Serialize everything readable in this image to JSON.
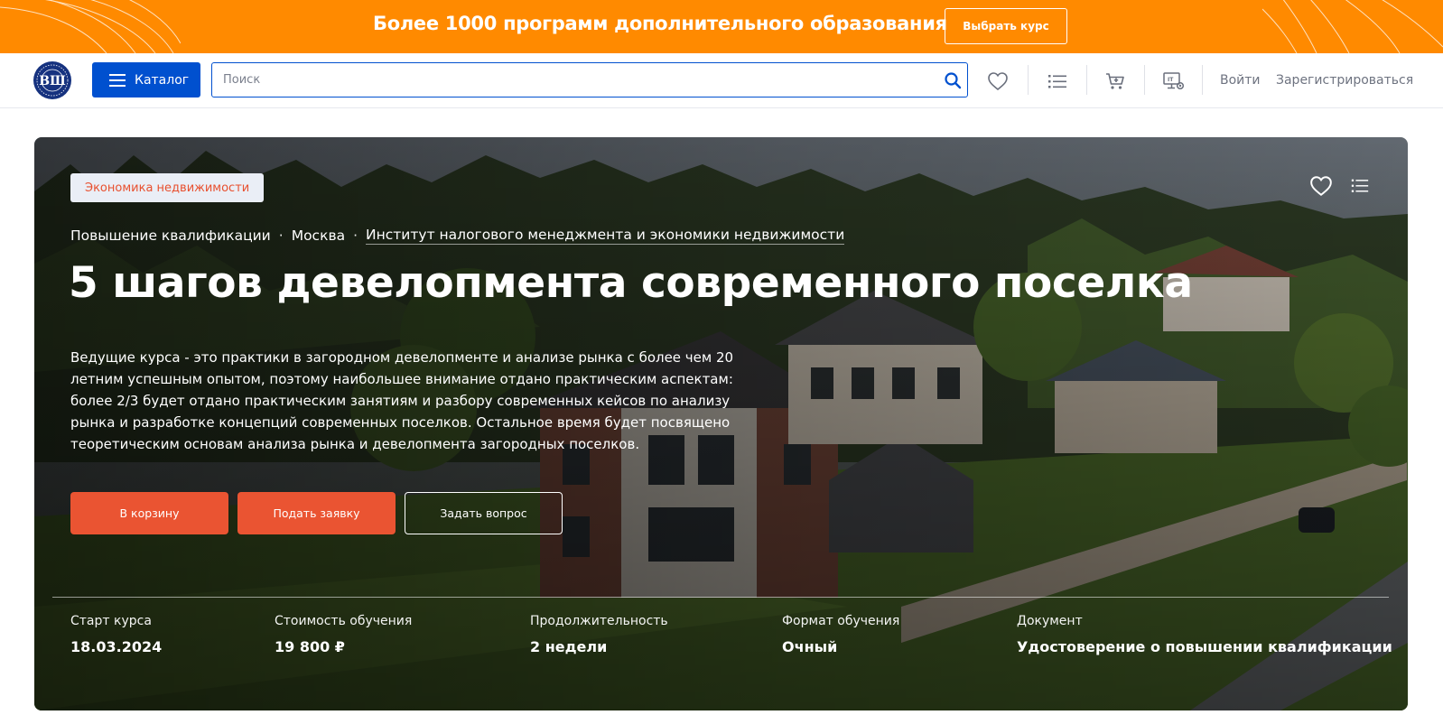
{
  "promo": {
    "text": "Более 1000 программ дополнительного образования",
    "button": "Выбрать курс"
  },
  "header": {
    "logo_icon": "hse-logo-icon",
    "catalog_label": "Каталог",
    "search_placeholder": "Поиск",
    "search_value": "",
    "icons": [
      "heart-icon",
      "list-icon",
      "cart-icon",
      "it-computer-icon"
    ],
    "login": "Войти",
    "register": "Зарегистрироваться"
  },
  "hero": {
    "tag": "Экономика недвижимости",
    "breadcrumbs": [
      "Повышение квалификации",
      "Москва",
      "Институт налогового менеджмента и экономики недвижимости"
    ],
    "title": "5 шагов девелопмента современного поселка",
    "description": "Ведущие курса - это практики в загородном девелопменте и анализе рынка с более чем 20 летним успешным опытом, поэтому наибольшее внимание отдано практическим аспектам: более 2/3 будет отдано практическим занятиям и разбору современных кейсов по анализу рынка и разработке концепций современных поселков. Остальное время будет посвящено теоретическим основам анализа рынка и девелопмента загородных поселков.",
    "buttons": {
      "cart": "В корзину",
      "apply": "Подать заявку",
      "question": "Задать вопрос"
    },
    "facts": [
      {
        "label": "Старт курса",
        "value": "18.03.2024"
      },
      {
        "label": "Стоимость обучения",
        "value": "19 800 ₽"
      },
      {
        "label": "Продолжительность",
        "value": "2 недели"
      },
      {
        "label": "Формат обучения",
        "value": "Очный"
      },
      {
        "label": "Документ",
        "value": "Удостоверение о повышении квалификации"
      }
    ]
  },
  "colors": {
    "promo": "#ff8a00",
    "brand_blue": "#0050cf",
    "accent_red": "#ea5432"
  }
}
